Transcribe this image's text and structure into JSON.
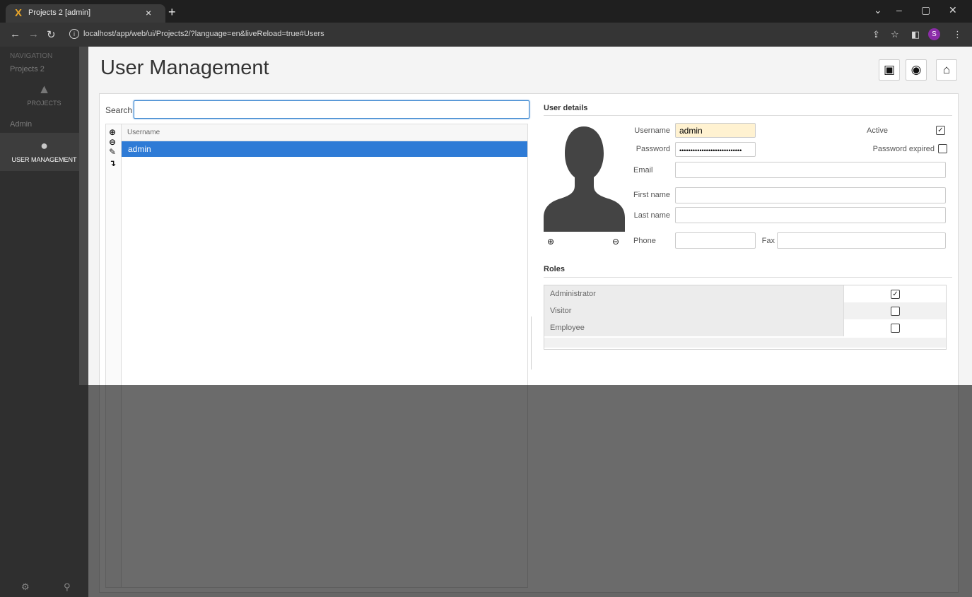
{
  "browser": {
    "tab_title": "Projects 2 [admin]",
    "tab_close": "×",
    "new_tab": "+",
    "favicon": "X",
    "url": "localhost/app/web/ui/Projects2/?language=en&liveReload=true#Users",
    "profile_initial": "S",
    "window_controls": [
      "⌄",
      "–",
      "▢",
      "✕"
    ]
  },
  "sidebar": {
    "navigation_header": "NAVIGATION",
    "project_name": "Projects 2",
    "projects_label": "PROJECTS",
    "admin_header": "Admin",
    "user_management_label": "USER MANAGEMENT"
  },
  "page": {
    "title": "User Management"
  },
  "search": {
    "label": "Search",
    "value": ""
  },
  "users_grid": {
    "column_username": "Username",
    "rows": [
      "admin"
    ],
    "selected_index": 0
  },
  "details": {
    "title": "User details",
    "username_label": "Username",
    "username_value": "admin",
    "password_label": "Password",
    "password_value": "••••••••••••••••••••••••••••",
    "email_label": "Email",
    "email_value": "",
    "first_name_label": "First name",
    "first_name_value": "",
    "last_name_label": "Last name",
    "last_name_value": "",
    "phone_label": "Phone",
    "phone_value": "",
    "fax_label": "Fax",
    "fax_value": "",
    "active_label": "Active",
    "active_checked": true,
    "password_expired_label": "Password expired",
    "password_expired_checked": false
  },
  "roles": {
    "title": "Roles",
    "items": [
      {
        "name": "Administrator",
        "checked": true
      },
      {
        "name": "Visitor",
        "checked": false
      },
      {
        "name": "Employee",
        "checked": false
      }
    ]
  },
  "icons": {
    "save": "save-icon",
    "reload": "reload-icon",
    "home": "home-icon",
    "add": "plus-circle-icon",
    "remove": "minus-circle-icon",
    "edit": "pencil-icon",
    "import": "arrow-icon"
  },
  "colors": {
    "selection": "#2e7bd6",
    "sidebar": "#2f2f2f",
    "highlight_field": "#fff2d1",
    "search_focus": "#3a86d0"
  }
}
